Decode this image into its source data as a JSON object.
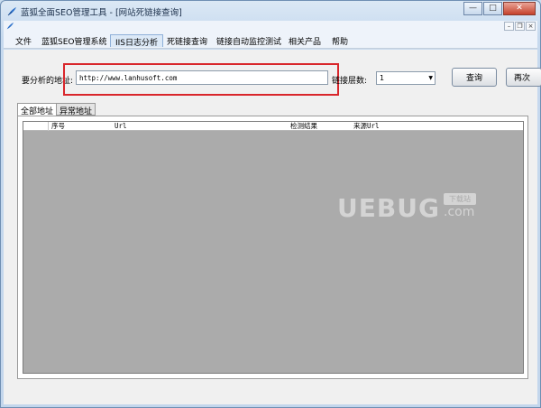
{
  "window": {
    "title": "蓝狐全面SEO管理工具 - [网站死链接查询]",
    "controls": {
      "minimize": "—",
      "maximize": "□",
      "close": "✕"
    }
  },
  "mdi": {
    "minimize": "–",
    "restore": "❐",
    "close": "×"
  },
  "menu": {
    "items": [
      {
        "label": "文件"
      },
      {
        "label": "蓝狐SEO管理系统"
      },
      {
        "label": "IIS日志分析"
      },
      {
        "label": "死链接查询"
      },
      {
        "label": "链接自动监控测试"
      },
      {
        "label": "相关产品"
      },
      {
        "label": "帮助"
      }
    ],
    "active_index": 2
  },
  "form": {
    "url_label": "要分析的地址:",
    "url_value": "http://www.lanhusoft.com",
    "depth_label": "链接层数:",
    "depth_value": "1",
    "query_button": "查询",
    "again_button": "再次"
  },
  "tabs": [
    {
      "label": "全部地址",
      "active": true
    },
    {
      "label": "异常地址",
      "active": false
    }
  ],
  "grid": {
    "columns": [
      "序号",
      "Url",
      "检测结果",
      "来源Url"
    ]
  },
  "watermark": {
    "main": "UEBUG",
    "suffix": ".com",
    "badge": "下载站"
  },
  "colors": {
    "highlight": "#d9262b",
    "grid_bg": "#ababab",
    "titlebar": "#c6d9ee"
  }
}
